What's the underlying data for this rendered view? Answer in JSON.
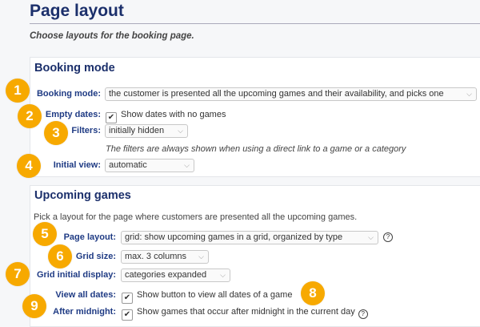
{
  "page": {
    "title": "Page layout",
    "subtitle": "Choose layouts for the booking page."
  },
  "booking": {
    "heading": "Booking mode",
    "mode_label": "Booking mode:",
    "mode_value": "the customer is presented all the upcoming games and their availability, and picks one",
    "empty_label": "Empty dates:",
    "empty_text": "Show dates with no games",
    "empty_checked": true,
    "filters_label": "Filters:",
    "filters_value": "initially hidden",
    "filters_note": "The filters are always shown when using a direct link to a game or a category",
    "view_label": "Initial view:",
    "view_value": "automatic"
  },
  "upcoming": {
    "heading": "Upcoming games",
    "intro": "Pick a layout for the page where customers are presented all the upcoming games.",
    "layout_label": "Page layout:",
    "layout_value": "grid: show upcoming games in a grid, organized by type",
    "size_label": "Grid size:",
    "size_value": "max. 3 columns",
    "display_label": "Grid initial display:",
    "display_value": "categories expanded",
    "alldates_label": "View all dates:",
    "alldates_text": "Show button to view all dates of a game",
    "alldates_checked": true,
    "midnight_label": "After midnight:",
    "midnight_text": "Show games that occur after midnight in the current day",
    "midnight_checked": true
  },
  "badges": [
    "1",
    "2",
    "3",
    "4",
    "5",
    "6",
    "7",
    "8",
    "9"
  ],
  "icons": {
    "chevron": "chevron-down-icon",
    "check": "check-icon",
    "help": "help-circle-icon"
  },
  "colors": {
    "badge": "#f7a900",
    "heading": "#1b2f6b",
    "label": "#1f3b84"
  }
}
